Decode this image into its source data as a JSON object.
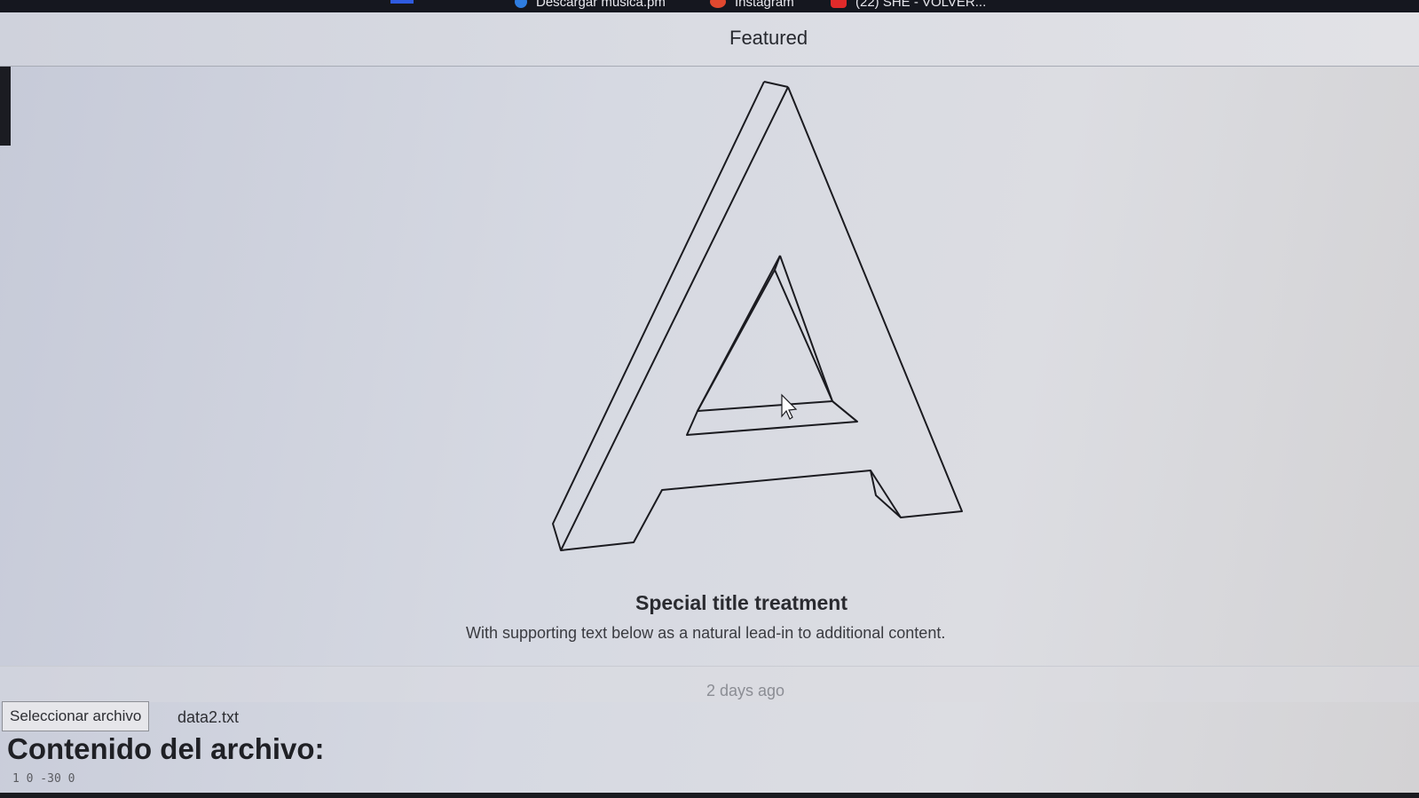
{
  "bookmarks": [
    {
      "label": "Descargar música.pm",
      "icon": "globe-icon",
      "color": "#2f7de0"
    },
    {
      "label": "Instagram",
      "icon": "instagram-icon",
      "color": "#e0482f"
    },
    {
      "label": "(22) SHE - VOLVER...",
      "icon": "youtube-icon",
      "color": "#e02a2a"
    }
  ],
  "card": {
    "header": "Featured",
    "image_icon": "letter-a-3d-logo",
    "title": "Special title treatment",
    "text": "With supporting text below as a natural lead-in to additional content.",
    "footer": "2 days ago"
  },
  "file_input": {
    "button_label": "Seleccionar archivo",
    "file_name": "data2.txt"
  },
  "content": {
    "heading": "Contenido del archivo:",
    "output": "1 0 -30 0"
  }
}
